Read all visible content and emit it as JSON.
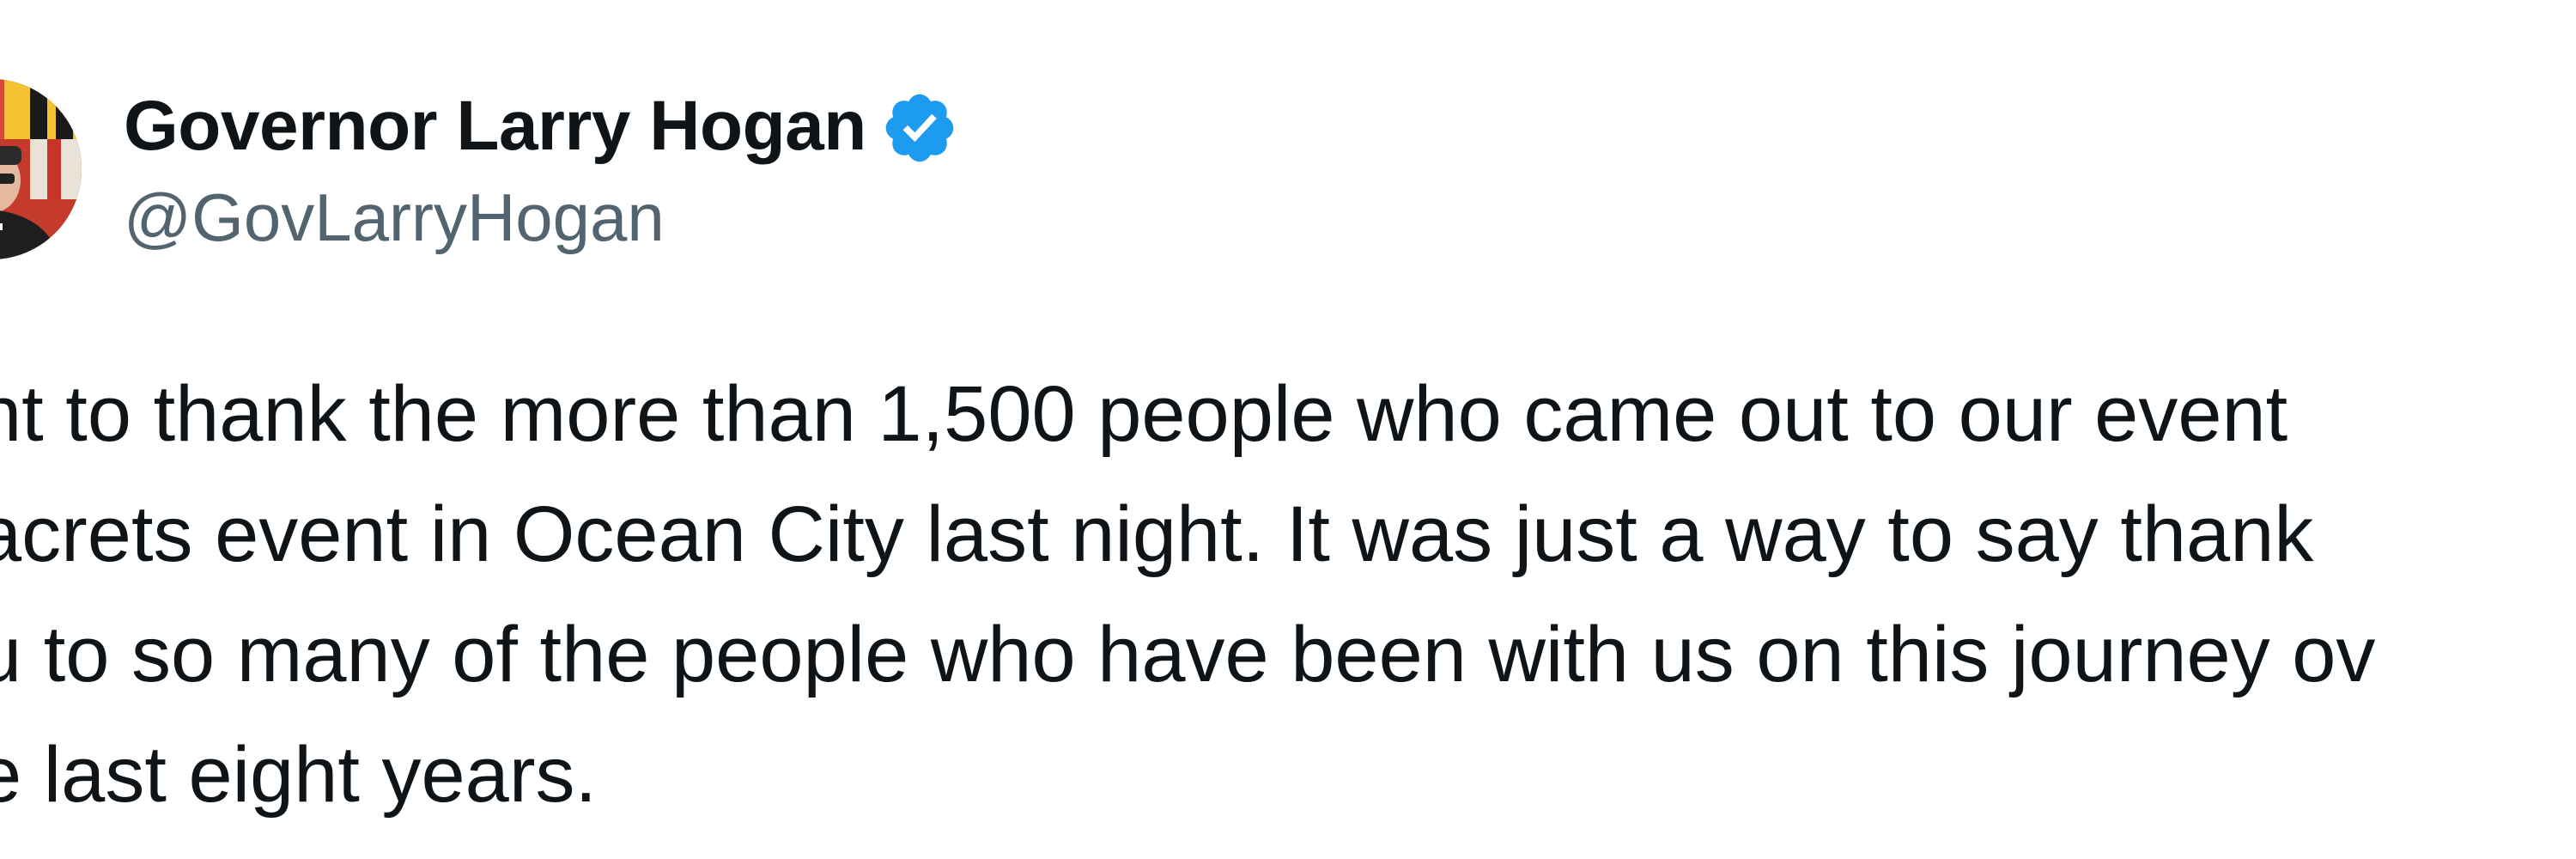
{
  "tweet": {
    "author": {
      "display_name": "Governor Larry Hogan",
      "handle": "@GovLarryHogan",
      "verified_icon": "verified-badge-icon",
      "avatar_icon": "profile-avatar"
    },
    "text_lines": [
      "nt to thank the more than 1,500 people who came out to our event",
      "acrets event in Ocean City last night. It was just a way to say thank",
      "u to so many of the people who have been with us on this journey ov",
      "e last eight years."
    ]
  },
  "colors": {
    "text_primary": "#0f1419",
    "text_secondary": "#536471",
    "verified_blue": "#1d9bf0"
  }
}
